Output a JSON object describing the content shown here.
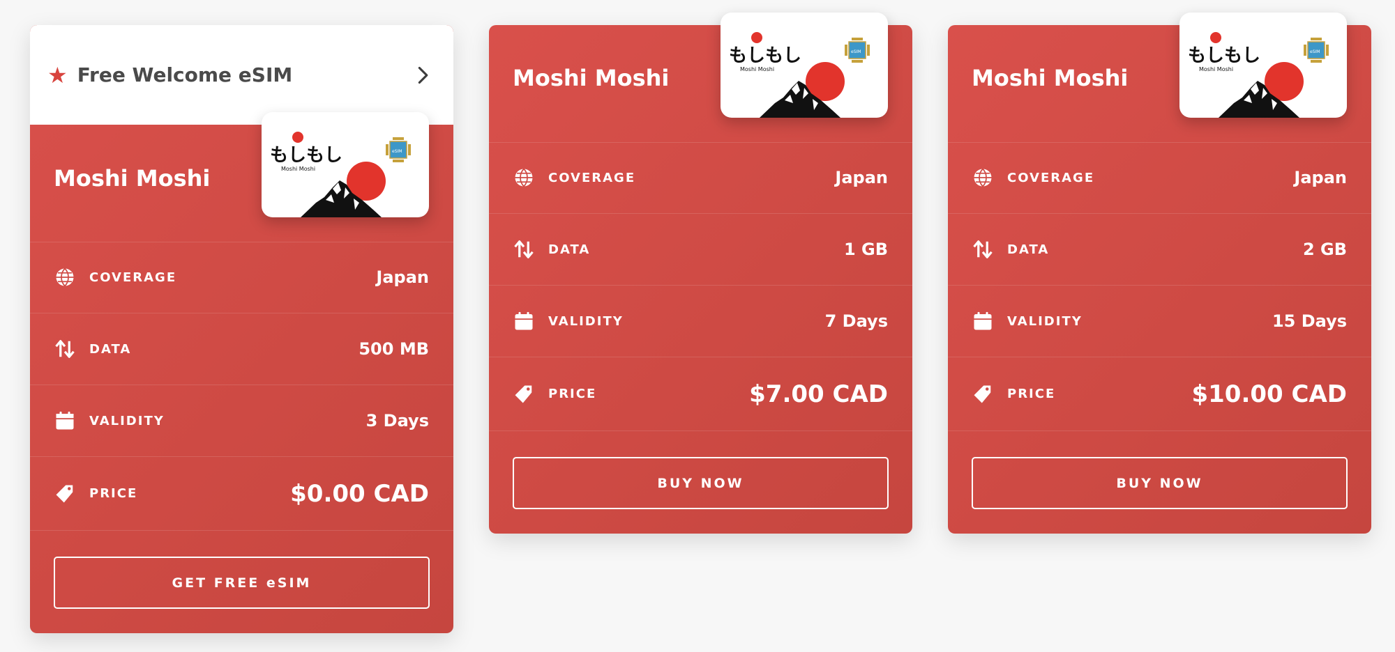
{
  "colors": {
    "accent": "#d9504b",
    "accent_dark": "#c6463f",
    "white": "#ffffff",
    "text_dark": "#4a4a4a"
  },
  "welcome": {
    "label": "Free Welcome eSIM",
    "icon": "star-icon",
    "arrow_icon": "chevron-right-icon"
  },
  "sim_art": {
    "logo_text": "もしもし",
    "logo_sub": "Moshi Moshi",
    "chip_label": "eSIM"
  },
  "labels": {
    "coverage": "COVERAGE",
    "data": "DATA",
    "validity": "VALIDITY",
    "price": "PRICE"
  },
  "plans": [
    {
      "name": "Moshi Moshi",
      "coverage": "Japan",
      "data": "500 MB",
      "validity": "3 Days",
      "price": "$0.00 CAD",
      "button": "GET FREE eSIM"
    },
    {
      "name": "Moshi Moshi",
      "coverage": "Japan",
      "data": "1 GB",
      "validity": "7 Days",
      "price": "$7.00 CAD",
      "button": "BUY NOW"
    },
    {
      "name": "Moshi Moshi",
      "coverage": "Japan",
      "data": "2 GB",
      "validity": "15 Days",
      "price": "$10.00 CAD",
      "button": "BUY NOW"
    }
  ]
}
